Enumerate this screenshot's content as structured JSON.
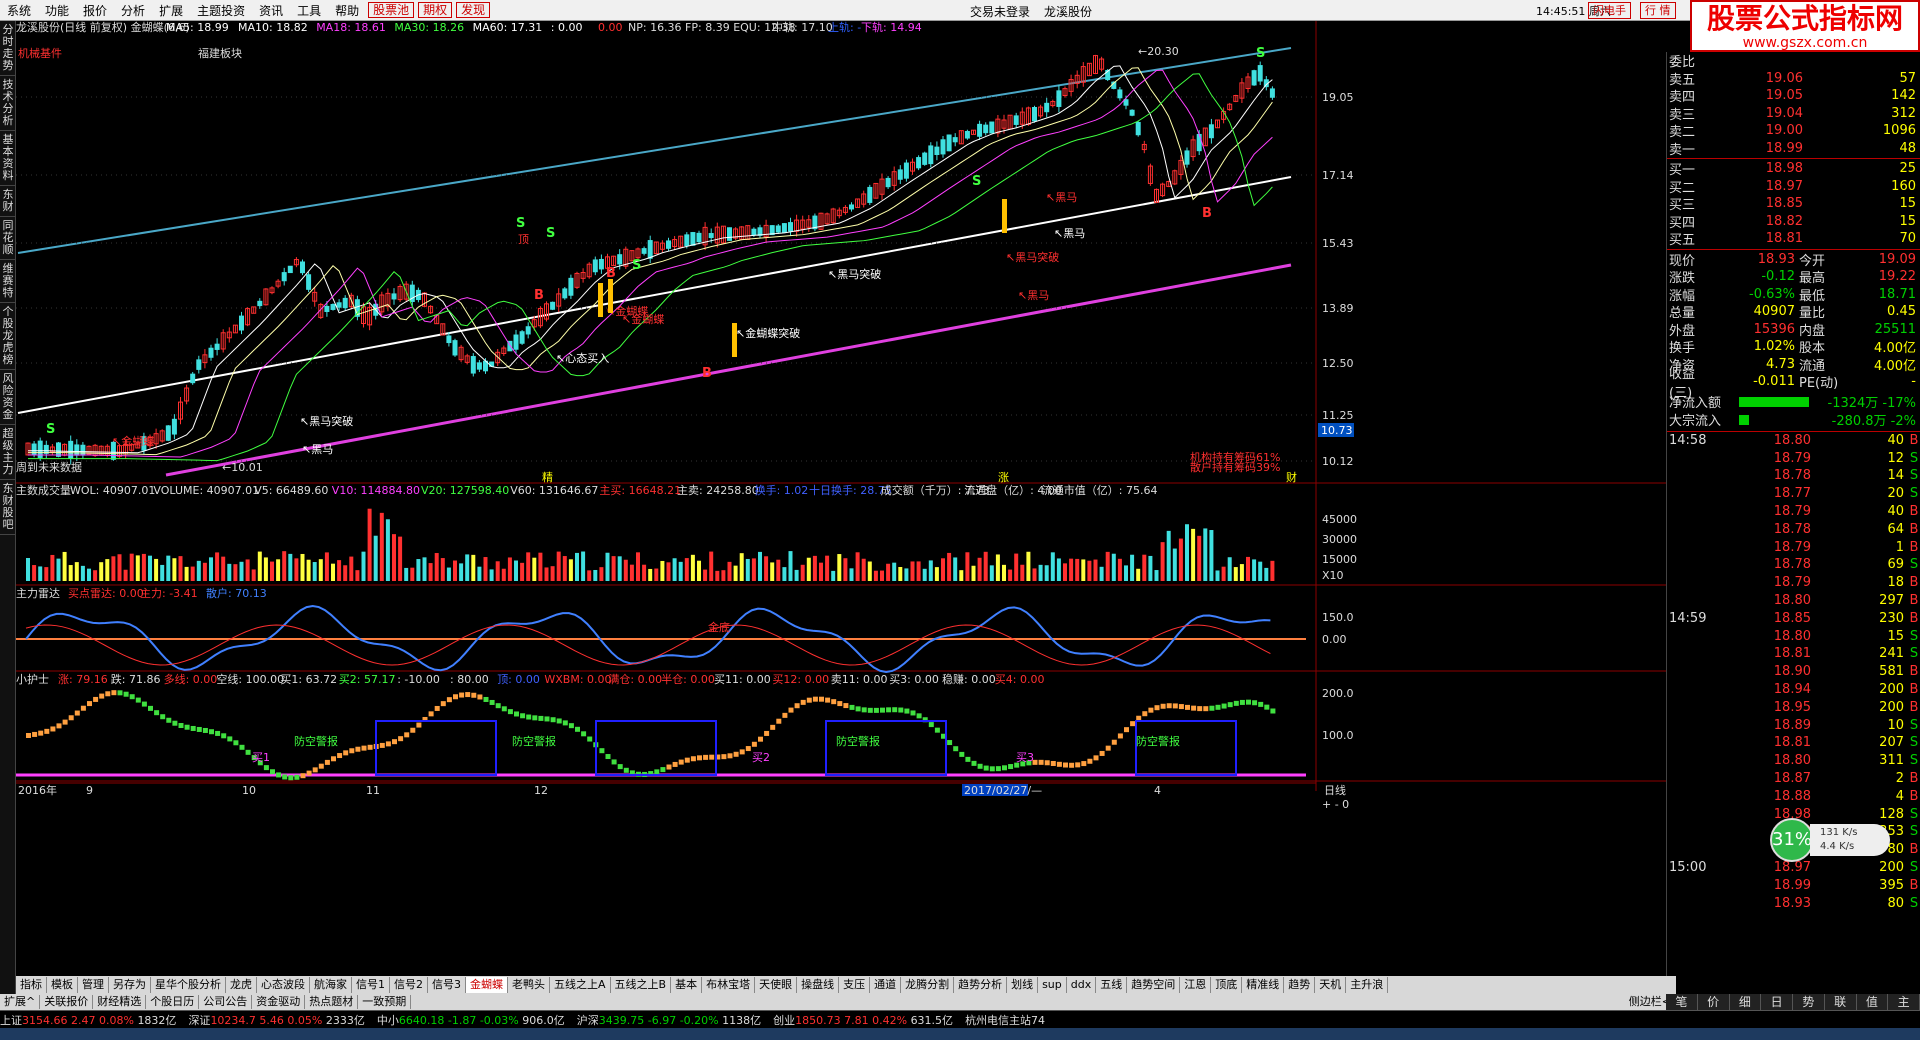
{
  "menu": [
    "系统",
    "功能",
    "报价",
    "分析",
    "扩展",
    "主题投资",
    "资讯",
    "工具",
    "帮助"
  ],
  "menu_red": [
    "股票池",
    "期权",
    "发现"
  ],
  "top_status": [
    "交易未登录",
    "龙溪股份"
  ],
  "clock": "14:45:51",
  "weekday": "周六",
  "flash_btn": "闪电手",
  "quote_btn": "行 情",
  "logo": {
    "title": "股票公式指标网",
    "url": "www.gszx.com.cn"
  },
  "left_tabs": [
    "分时走势",
    "技术分析",
    "基本资料",
    "东财",
    "同花顺",
    "维赛特",
    "个股龙虎榜",
    "风险资金",
    "超级主力",
    "东财股吧"
  ],
  "main_chart": {
    "title": "龙溪股份(日线 前复权) 金蝴蝶(6,6)",
    "ma": [
      {
        "label": "MA5: 18.99",
        "color": "#ffffff"
      },
      {
        "label": "MA10: 18.82",
        "color": "#ffffff"
      },
      {
        "label": "MA18: 18.61",
        "color": "#ff40ff"
      },
      {
        "label": "MA30: 18.26",
        "color": "#40ff40"
      },
      {
        "label": "MA60: 17.31",
        "color": "#ffffff"
      },
      {
        "label": ": 0.00",
        "color": "#ffffff"
      },
      {
        "label": "0.00",
        "color": "#ff3030"
      }
    ],
    "np_line": "NP: 16.36  FP: 8.39  EQU: 12.38",
    "mid": "中轨: 17.10",
    "upper": "上轨: -",
    "lower": "下轨: 14.94",
    "sector1": "机械基件",
    "sector2": "福建板块",
    "price_ticks": [
      "19.05",
      "17.14",
      "15.43",
      "13.89",
      "12.50",
      "11.25",
      "10.12"
    ],
    "cur_price_tag": "10.73",
    "high_label": "20.30",
    "low_label": "10.01",
    "hold1": "机构持有筹码61%",
    "hold2": "散户持有筹码39%",
    "future_label": "周到未来数据",
    "annotations": [
      "黑马突破",
      "金蝴蝶",
      "黑马",
      "金蝴蝶",
      "黑马突破",
      "黑马",
      "心态买入",
      "金蝴蝶",
      "金蝴蝶突破",
      "黑马突破",
      "黑马",
      "黑马"
    ],
    "markers": [
      "精",
      "涨",
      "财"
    ],
    "signal_letters": [
      "S",
      "S",
      "S",
      "S",
      "S",
      "S",
      "B",
      "B",
      "B",
      "B"
    ],
    "top_label": "顶"
  },
  "volume_panel": {
    "title": "主数成交量",
    "items": [
      {
        "t": "WOL: 40907.01",
        "c": "#ddd"
      },
      {
        "t": "VOLUME: 40907.01",
        "c": "#ddd"
      },
      {
        "t": "V5: 66489.60",
        "c": "#ddd"
      },
      {
        "t": "V10: 114884.80",
        "c": "#ff40ff"
      },
      {
        "t": "V20: 127598.40",
        "c": "#40ff40"
      },
      {
        "t": "V60: 131646.67",
        "c": "#ddd"
      },
      {
        "t": "主买: 16648.21",
        "c": "#ff3030"
      },
      {
        "t": "主卖: 24258.80",
        "c": "#ddd"
      },
      {
        "t": "换手: 1.02",
        "c": "#4060ff"
      },
      {
        "t": "十日换手: 28.75",
        "c": "#4060ff"
      },
      {
        "t": "成交额（千万）: 7.73",
        "c": "#ddd"
      },
      {
        "t": "流通盘（亿）: 4.00",
        "c": "#ddd"
      },
      {
        "t": "流通市值（亿）: 75.64",
        "c": "#ddd"
      }
    ],
    "ticks": [
      "45000",
      "30000",
      "15000"
    ],
    "unit": "X10"
  },
  "radar_panel": {
    "title": "主力雷达",
    "items": [
      {
        "t": "买点雷达: 0.00",
        "c": "#ff3030"
      },
      {
        "t": "主力: -3.41",
        "c": "#ff3030"
      },
      {
        "t": "散户: 70.13",
        "c": "#4080ff"
      }
    ],
    "ticks": [
      "150.0",
      "0.00"
    ],
    "label": "金底"
  },
  "nurse_panel": {
    "title": "小护士",
    "items": [
      {
        "t": "涨: 79.16",
        "c": "#ff3030"
      },
      {
        "t": "跌: 71.86",
        "c": "#ddd"
      },
      {
        "t": "多线: 0.00",
        "c": "#ff3030"
      },
      {
        "t": "空线: 100.00",
        "c": "#ddd"
      },
      {
        "t": "买1: 63.72",
        "c": "#ddd"
      },
      {
        "t": "买2: 57.17",
        "c": "#40ff40"
      },
      {
        "t": ": -10.00",
        "c": "#ddd"
      },
      {
        "t": ": 80.00",
        "c": "#ddd"
      },
      {
        "t": "顶: 0.00",
        "c": "#4060ff"
      },
      {
        "t": "WXBM: 0.00",
        "c": "#ff3030"
      },
      {
        "t": "满仓: 0.00",
        "c": "#ff3030"
      },
      {
        "t": "半仓: 0.00",
        "c": "#ff3030"
      },
      {
        "t": "买11: 0.00",
        "c": "#ddd"
      },
      {
        "t": "买12: 0.00",
        "c": "#ff3030"
      },
      {
        "t": "卖11: 0.00",
        "c": "#ddd"
      },
      {
        "t": "买3: 0.00",
        "c": "#ddd"
      },
      {
        "t": "稳赚: 0.00",
        "c": "#ddd"
      },
      {
        "t": "买4: 0.00",
        "c": "#ff3030"
      }
    ],
    "ticks": [
      "200.0",
      "100.0"
    ],
    "alarm": "防空警报",
    "labels": [
      "买1",
      "买2",
      "买3"
    ]
  },
  "x_axis": {
    "labels": [
      "2016年",
      "9",
      "10",
      "11",
      "12",
      "2017/02/27/—",
      "4"
    ],
    "period": "日线"
  },
  "tabs": [
    "指标",
    "模板",
    "管理",
    "另存为",
    "星华个股分析",
    "龙虎",
    "心态波段",
    "航海家",
    "信号1",
    "信号2",
    "信号3",
    "金蝴蝶",
    "老鸭头",
    "五线之上A",
    "五线之上B",
    "基本",
    "布林宝塔",
    "天使眼",
    "操盘线",
    "支压",
    "通道",
    "龙腾分割",
    "趋势分析",
    "划线",
    "sup",
    "ddx",
    "五线",
    "趋势空间",
    "江恩",
    "顶底",
    "精准线",
    "趋势",
    "天机",
    "主升浪"
  ],
  "active_tab": "金蝴蝶",
  "tabs2": [
    "扩展^",
    "关联报价",
    "财经精选",
    "个股日历",
    "公司公告",
    "资金驱动",
    "热点题材",
    "一致预期"
  ],
  "status_bar": [
    {
      "name": "上证",
      "val": "3154.66",
      "chg": "2.47",
      "pct": "0.08%",
      "amt": "1832亿",
      "dir": "up"
    },
    {
      "name": "深证",
      "val": "10234.7",
      "chg": "5.46",
      "pct": "0.05%",
      "amt": "2333亿",
      "dir": "up"
    },
    {
      "name": "中小",
      "val": "6640.18",
      "chg": "-1.87",
      "pct": "-0.03%",
      "amt": "906.0亿",
      "dir": "dn"
    },
    {
      "name": "沪深",
      "val": "3439.75",
      "chg": "-6.97",
      "pct": "-0.20%",
      "amt": "1138亿",
      "dir": "dn"
    },
    {
      "name": "创业",
      "val": "1850.73",
      "chg": "7.81",
      "pct": "0.42%",
      "amt": "631.5亿",
      "dir": "up"
    }
  ],
  "status_extra": "杭州电信主站74",
  "status_extra2": "杭州电信主站74",
  "right_panel": {
    "head_label": "委比",
    "sell": [
      {
        "l": "卖五",
        "p": "19.06",
        "v": "57"
      },
      {
        "l": "卖四",
        "p": "19.05",
        "v": "142"
      },
      {
        "l": "卖三",
        "p": "19.04",
        "v": "312"
      },
      {
        "l": "卖二",
        "p": "19.00",
        "v": "1096"
      },
      {
        "l": "卖一",
        "p": "18.99",
        "v": "48"
      }
    ],
    "buy": [
      {
        "l": "买一",
        "p": "18.98",
        "v": "25"
      },
      {
        "l": "买二",
        "p": "18.97",
        "v": "160"
      },
      {
        "l": "买三",
        "p": "18.85",
        "v": "15"
      },
      {
        "l": "买四",
        "p": "18.82",
        "v": "15"
      },
      {
        "l": "买五",
        "p": "18.81",
        "v": "70"
      }
    ],
    "stats": [
      {
        "a": "现价",
        "av": "18.93",
        "ac": "#ff3030",
        "b": "今开",
        "bv": "19.09",
        "bc": "#ff3030"
      },
      {
        "a": "涨跌",
        "av": "-0.12",
        "ac": "#00d000",
        "b": "最高",
        "bv": "19.22",
        "bc": "#ff3030"
      },
      {
        "a": "涨幅",
        "av": "-0.63%",
        "ac": "#00d000",
        "b": "最低",
        "bv": "18.71",
        "bc": "#00d000"
      },
      {
        "a": "总量",
        "av": "40907",
        "ac": "#ffff00",
        "b": "量比",
        "bv": "0.45",
        "bc": "#ffff00"
      },
      {
        "a": "外盘",
        "av": "15396",
        "ac": "#ff3030",
        "b": "内盘",
        "bv": "25511",
        "bc": "#00d000"
      },
      {
        "a": "换手",
        "av": "1.02%",
        "ac": "#ffff00",
        "b": "股本",
        "bv": "4.00亿",
        "bc": "#ffff00"
      },
      {
        "a": "净资",
        "av": "4.73",
        "ac": "#ffff00",
        "b": "流通",
        "bv": "4.00亿",
        "bc": "#ffff00"
      },
      {
        "a": "收益(三)",
        "av": "-0.011",
        "ac": "#ffff00",
        "b": "PE(动)",
        "bv": "-",
        "bc": "#ffff00"
      }
    ],
    "flow": [
      {
        "l": "净流入额",
        "v": "-1324万",
        "p": "-17%"
      },
      {
        "l": "大宗流入",
        "v": "-280.8万",
        "p": "-2%"
      }
    ],
    "ticks": [
      {
        "t": "14:58",
        "p": "18.80",
        "v": "40",
        "d": "B"
      },
      {
        "t": "",
        "p": "18.79",
        "v": "12",
        "d": "S"
      },
      {
        "t": "",
        "p": "18.78",
        "v": "14",
        "d": "S"
      },
      {
        "t": "",
        "p": "18.77",
        "v": "20",
        "d": "S"
      },
      {
        "t": "",
        "p": "18.79",
        "v": "40",
        "d": "B"
      },
      {
        "t": "",
        "p": "18.78",
        "v": "64",
        "d": "B"
      },
      {
        "t": "",
        "p": "18.79",
        "v": "1",
        "d": "B"
      },
      {
        "t": "",
        "p": "18.78",
        "v": "69",
        "d": "S"
      },
      {
        "t": "",
        "p": "18.79",
        "v": "18",
        "d": "B"
      },
      {
        "t": "",
        "p": "18.80",
        "v": "297",
        "d": "B"
      },
      {
        "t": "14:59",
        "p": "18.85",
        "v": "230",
        "d": "B"
      },
      {
        "t": "",
        "p": "18.80",
        "v": "15",
        "d": "S"
      },
      {
        "t": "",
        "p": "18.81",
        "v": "241",
        "d": "S"
      },
      {
        "t": "",
        "p": "18.90",
        "v": "581",
        "d": "B"
      },
      {
        "t": "",
        "p": "18.94",
        "v": "200",
        "d": "B"
      },
      {
        "t": "",
        "p": "18.95",
        "v": "200",
        "d": "B"
      },
      {
        "t": "",
        "p": "18.89",
        "v": "10",
        "d": "S"
      },
      {
        "t": "",
        "p": "18.81",
        "v": "207",
        "d": "S"
      },
      {
        "t": "",
        "p": "18.80",
        "v": "311",
        "d": "S"
      },
      {
        "t": "",
        "p": "18.87",
        "v": "2",
        "d": "B"
      },
      {
        "t": "",
        "p": "18.88",
        "v": "4",
        "d": "B"
      },
      {
        "t": "",
        "p": "18.98",
        "v": "128",
        "d": "S"
      },
      {
        "t": "",
        "p": "18.98",
        "v": "353",
        "d": "S"
      },
      {
        "t": "",
        "p": "18.98",
        "v": "80",
        "d": "B"
      },
      {
        "t": "15:00",
        "p": "18.97",
        "v": "200",
        "d": "S"
      },
      {
        "t": "",
        "p": "18.99",
        "v": "395",
        "d": "B"
      },
      {
        "t": "",
        "p": "18.93",
        "v": "80",
        "d": "S"
      }
    ],
    "tabs": [
      "笔",
      "价",
      "细",
      "日",
      "势",
      "联",
      "值",
      "主"
    ]
  },
  "net_badge": {
    "pct": "31%",
    "up": "131 K/s",
    "down": "4.4 K/s"
  },
  "axis_period_ctrl": "+ - 0",
  "sidebar_toggle": "侧边栏<"
}
